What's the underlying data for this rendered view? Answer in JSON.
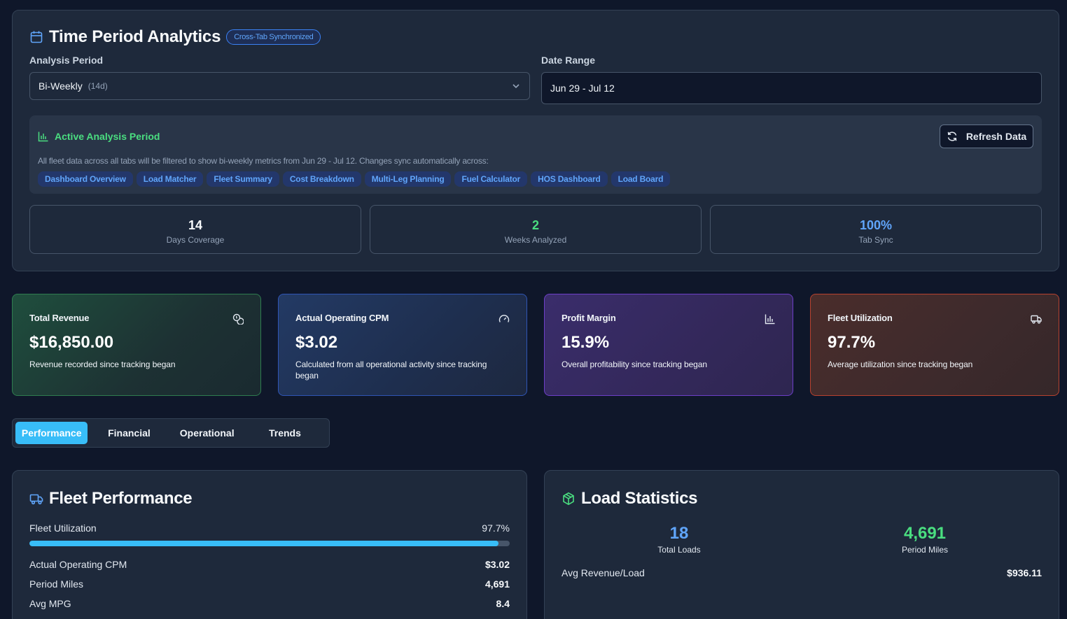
{
  "header": {
    "title": "Time Period Analytics",
    "badge": "Cross-Tab Synchronized"
  },
  "filters": {
    "analysis_period_label": "Analysis Period",
    "analysis_period_value": "Bi-Weekly",
    "analysis_period_hint": "(14d)",
    "date_range_label": "Date Range",
    "date_range_value": "Jun 29 - Jul 12"
  },
  "active_period": {
    "title": "Active Analysis Period",
    "refresh_label": "Refresh Data",
    "description": "All fleet data across all tabs will be filtered to show bi-weekly metrics from Jun 29 - Jul 12. Changes sync automatically across:",
    "tabs": [
      "Dashboard Overview",
      "Load Matcher",
      "Fleet Summary",
      "Cost Breakdown",
      "Multi-Leg Planning",
      "Fuel Calculator",
      "HOS Dashboard",
      "Load Board"
    ]
  },
  "period_stats": [
    {
      "value": "14",
      "label": "Days Coverage",
      "color": "#f8fafc"
    },
    {
      "value": "2",
      "label": "Weeks Analyzed",
      "color": "#4ade80"
    },
    {
      "value": "100%",
      "label": "Tab Sync",
      "color": "#60a5fa"
    }
  ],
  "kpis": [
    {
      "title": "Total Revenue",
      "value": "$16,850.00",
      "sub": "Revenue recorded since tracking began",
      "icon": "coins-icon"
    },
    {
      "title": "Actual Operating CPM",
      "value": "$3.02",
      "sub": "Calculated from all operational activity since tracking began",
      "icon": "gauge-icon"
    },
    {
      "title": "Profit Margin",
      "value": "15.9%",
      "sub": "Overall profitability since tracking began",
      "icon": "bar-chart-icon"
    },
    {
      "title": "Fleet Utilization",
      "value": "97.7%",
      "sub": "Average utilization since tracking began",
      "icon": "truck-icon"
    }
  ],
  "tabs": [
    "Performance",
    "Financial",
    "Operational",
    "Trends"
  ],
  "active_tab": "Performance",
  "fleet_performance": {
    "title": "Fleet Performance",
    "utilization_label": "Fleet Utilization",
    "utilization_value": "97.7%",
    "utilization_fraction": 0.977,
    "metrics": [
      {
        "label": "Actual Operating CPM",
        "value": "$3.02"
      },
      {
        "label": "Period Miles",
        "value": "4,691"
      },
      {
        "label": "Avg MPG",
        "value": "8.4"
      }
    ]
  },
  "load_statistics": {
    "title": "Load Statistics",
    "total_loads": "18",
    "total_loads_label": "Total Loads",
    "period_miles": "4,691",
    "period_miles_label": "Period Miles",
    "avg_revenue_label": "Avg Revenue/Load",
    "avg_revenue_value": "$936.11"
  },
  "colors": {
    "accent_blue": "#60a5fa",
    "accent_green": "#4ade80",
    "accent_cyan": "#38bdf8"
  }
}
